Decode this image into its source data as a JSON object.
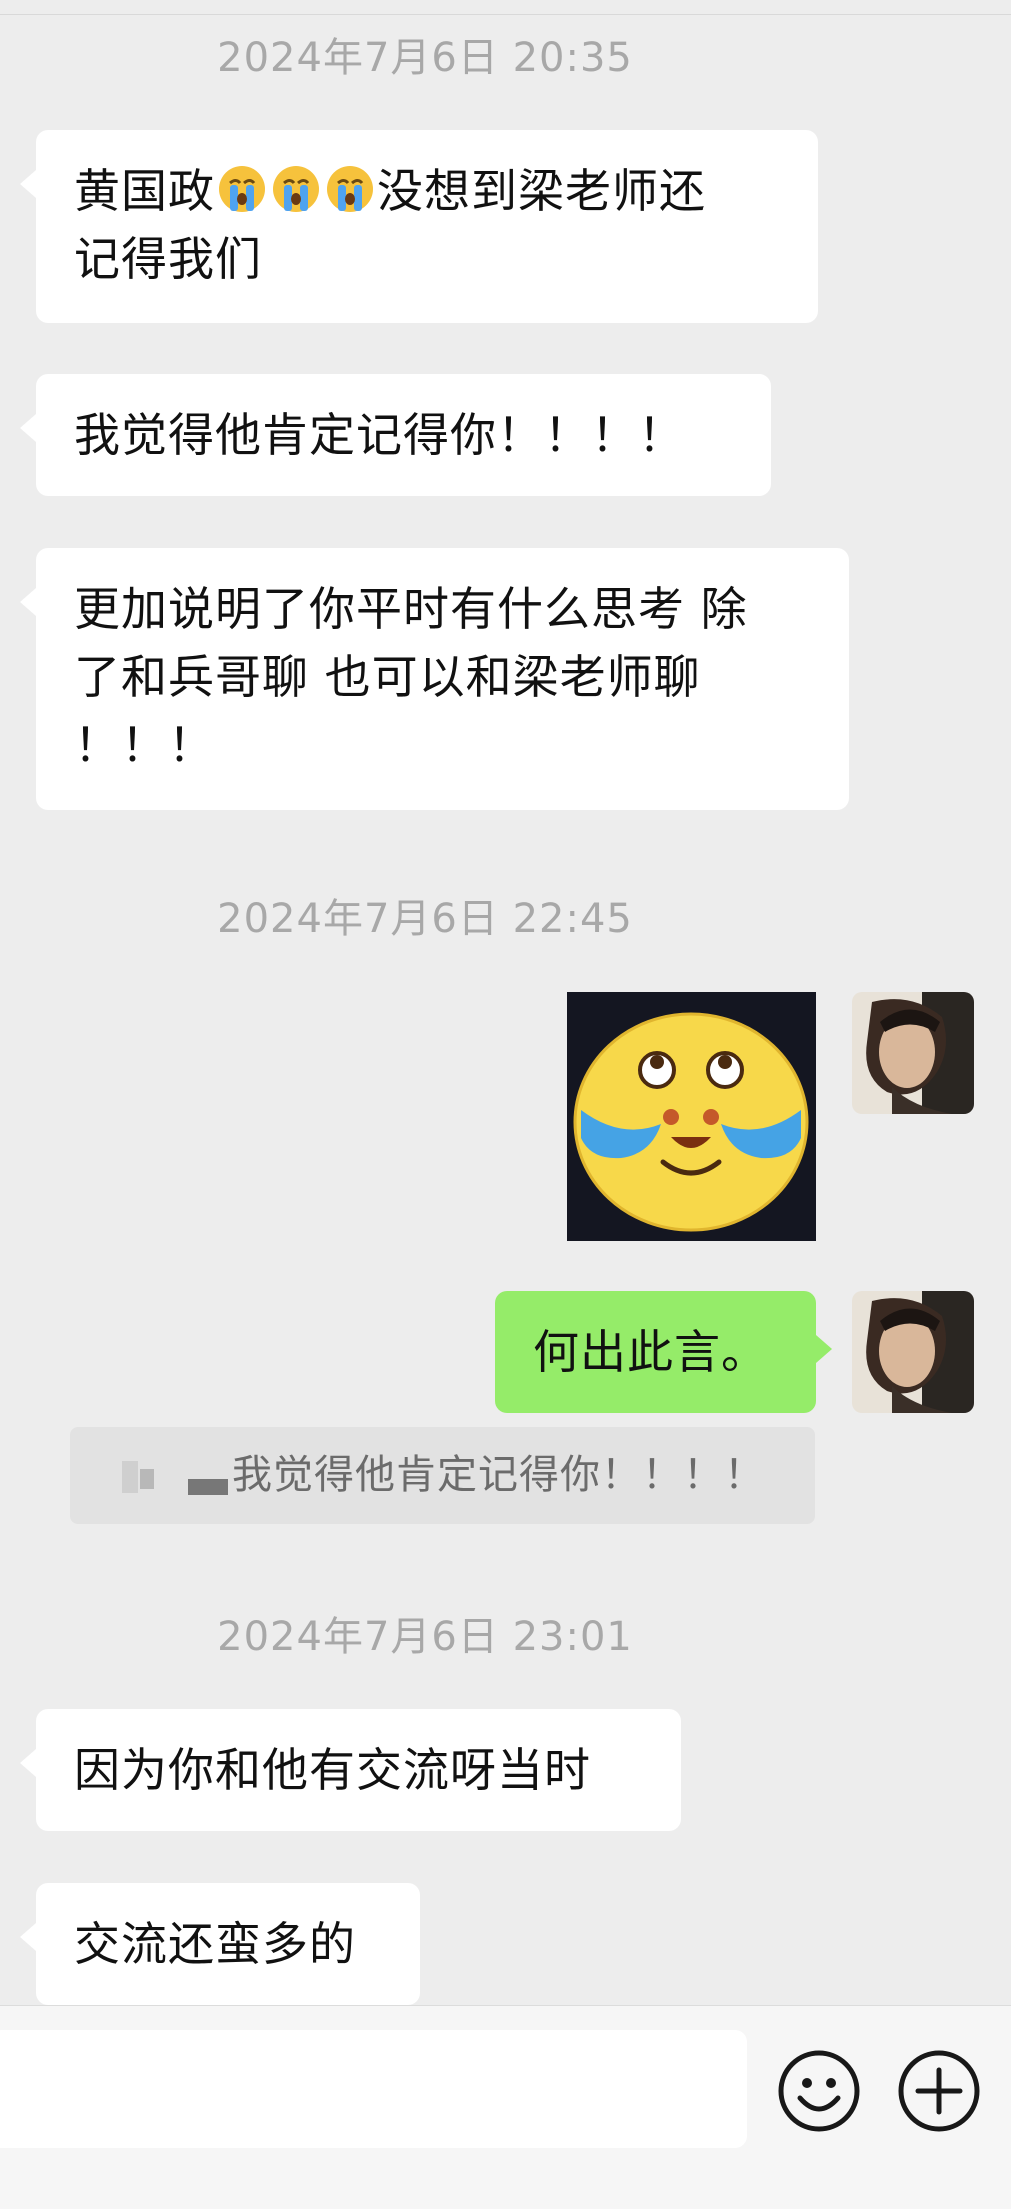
{
  "conversation": {
    "timestamps": [
      "2024年7月6日 20:35",
      "2024年7月6日 22:45",
      "2024年7月6日 23:01"
    ],
    "messages": {
      "m1_part1": "黄国政",
      "m1_part2": "没想到梁老师还",
      "m1_line2": "记得我们",
      "m1_emoji": "crying-face-emoji",
      "m2": "我觉得他肯定记得你！！！！",
      "m3_line1": "更加说明了你平时有什么思考 除",
      "m3_line2": "了和兵哥聊 也可以和梁老师聊",
      "m3_line3": "！！！",
      "m4_sticker": "crying-laughing-sticker",
      "m5": "何出此言。",
      "m5_quote": "我觉得他肯定记得你！！！！",
      "m6": "因为你和他有交流呀当时",
      "m7": "交流还蛮多的"
    }
  },
  "input_bar": {
    "placeholder": "",
    "emoji_button_icon": "smiley-icon",
    "more_button_icon": "plus-circle-icon"
  },
  "colors": {
    "background": "#ededed",
    "incoming_bubble": "#ffffff",
    "outgoing_bubble": "#95ec69",
    "timestamp_text": "#a8a8a8"
  }
}
